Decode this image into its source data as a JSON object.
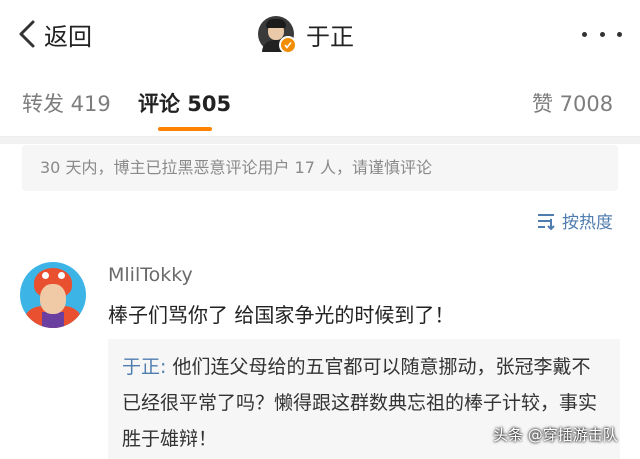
{
  "header": {
    "back_label": "返回",
    "title": "于正",
    "badge_color": "#f28c00",
    "icons": {
      "back": "chevron-left-icon",
      "more": "more-dots-icon"
    }
  },
  "tabs": [
    {
      "label": "转发 419",
      "active": false
    },
    {
      "label": "评论 505",
      "active": true
    },
    {
      "label": "赞 7008",
      "active": false
    }
  ],
  "accent_color": "#ff8200",
  "link_color": "#507daf",
  "notice": {
    "text": "30 天内，博主已拉黑恶意评论用户 17 人，请谨慎评论"
  },
  "sort": {
    "label": "按热度",
    "icon": "sort-icon"
  },
  "comment": {
    "username": "MlilTokky",
    "text": "棒子们骂你了 给国家争光的时候到了！",
    "reply": {
      "author": "于正:",
      "text": " 他们连父母给的五官都可以随意挪动，张冠李戴不已经很平常了吗？懒得跟这群数典忘祖的棒子计较，事实胜于雄辩！"
    }
  },
  "watermark": {
    "text": "头条 @穿插游击队"
  }
}
